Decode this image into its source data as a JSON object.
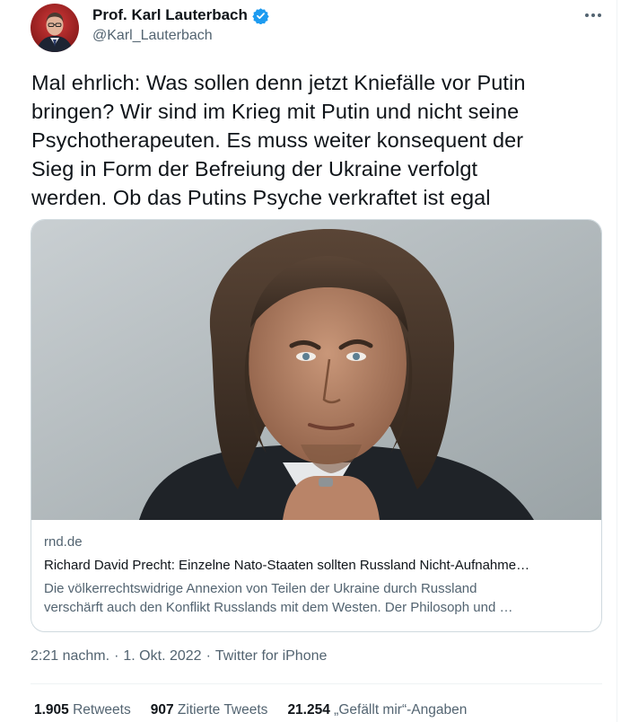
{
  "author": {
    "display_name": "Prof. Karl Lauterbach",
    "handle": "@Karl_Lauterbach",
    "verified_icon": "verified-badge-icon"
  },
  "tweet": {
    "text_lines": [
      "Mal ehrlich: Was sollen denn jetzt Kniefälle vor Putin",
      "bringen? Wir sind im Krieg mit Putin und nicht seine",
      "Psychotherapeuten. Es muss weiter konsequent der",
      "Sieg in Form der Befreiung der Ukraine verfolgt",
      "werden. Ob das Putins Psyche verkraftet ist egal"
    ]
  },
  "card": {
    "domain": "rnd.de",
    "title": "Richard David Precht: Einzelne Nato-Staaten sollten Russland Nicht-Aufnahme…",
    "description_lines": [
      "Die völkerrechtswidrige Annexion von Teilen der Ukraine durch Russland",
      "verschärft auch den Konflikt Russlands mit dem Westen. Der Philosoph und …"
    ]
  },
  "meta": {
    "time": "2:21 nachm.",
    "separator": "·",
    "date": "1. Okt. 2022",
    "source": "Twitter for iPhone"
  },
  "stats": {
    "retweets_count": "1.905",
    "retweets_label": "Retweets",
    "quotes_count": "907",
    "quotes_label": "Zitierte Tweets",
    "likes_count": "21.254",
    "likes_label": "„Gefällt mir“-Angaben"
  },
  "colors": {
    "text_primary": "#0f1419",
    "text_secondary": "#536471",
    "verified_blue": "#1d9bf0",
    "border": "#cfd9de"
  }
}
